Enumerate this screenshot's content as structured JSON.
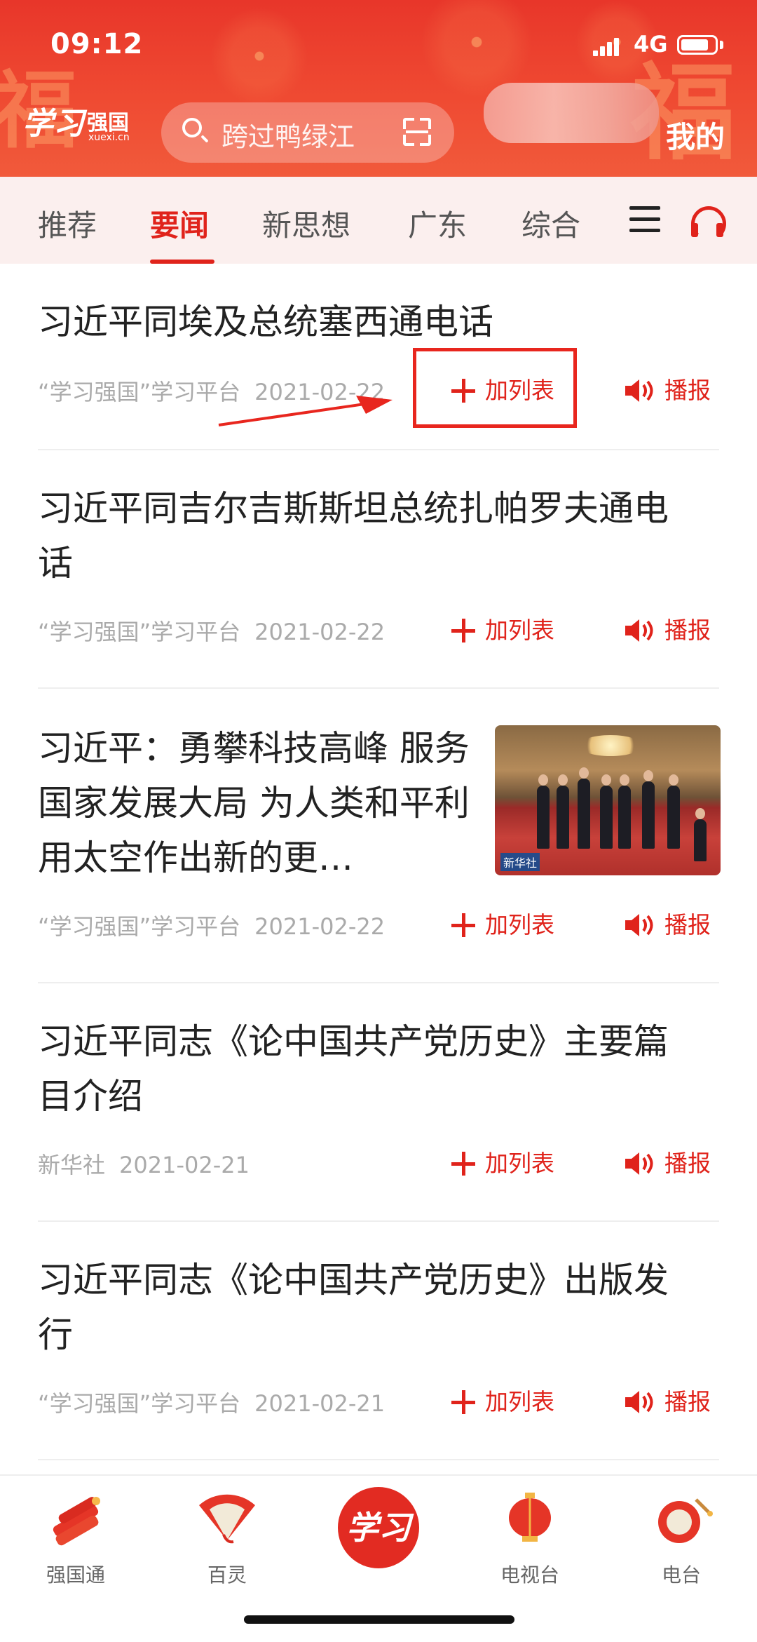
{
  "status": {
    "time": "09:12",
    "network": "4G"
  },
  "header": {
    "logo_main": "学习",
    "logo_sub": "强国",
    "logo_url": "xuexi.cn",
    "search_placeholder": "跨过鸭绿江",
    "mine_label": "我的"
  },
  "tabs": [
    "推荐",
    "要闻",
    "新思想",
    "广东",
    "综合"
  ],
  "active_tab": "要闻",
  "actions": {
    "add_list": "加列表",
    "broadcast": "播报"
  },
  "articles": [
    {
      "title": "习近平同埃及总统塞西通电话",
      "source": "“学习强国”学习平台",
      "date": "2021-02-22"
    },
    {
      "title": "习近平同吉尔吉斯斯坦总统扎帕罗夫通电话",
      "source": "“学习强国”学习平台",
      "date": "2021-02-22"
    },
    {
      "title": "习近平：勇攀科技高峰 服务国家发展大局 为人类和平利用太空作出新的更…",
      "source": "“学习强国”学习平台",
      "date": "2021-02-22",
      "thumb_watermark": "新华社"
    },
    {
      "title": "习近平同志《论中国共产党历史》主要篇目介绍",
      "source": "新华社",
      "date": "2021-02-21"
    },
    {
      "title": "习近平同志《论中国共产党历史》出版发行",
      "source": "“学习强国”学习平台",
      "date": "2021-02-21"
    }
  ],
  "bottom_nav": {
    "items": [
      "强国通",
      "百灵",
      "电视台",
      "电台"
    ],
    "center": "学习"
  },
  "colors": {
    "brand_red": "#e0231b",
    "header_red": "#e8362a",
    "tab_bg": "#fbefee"
  }
}
